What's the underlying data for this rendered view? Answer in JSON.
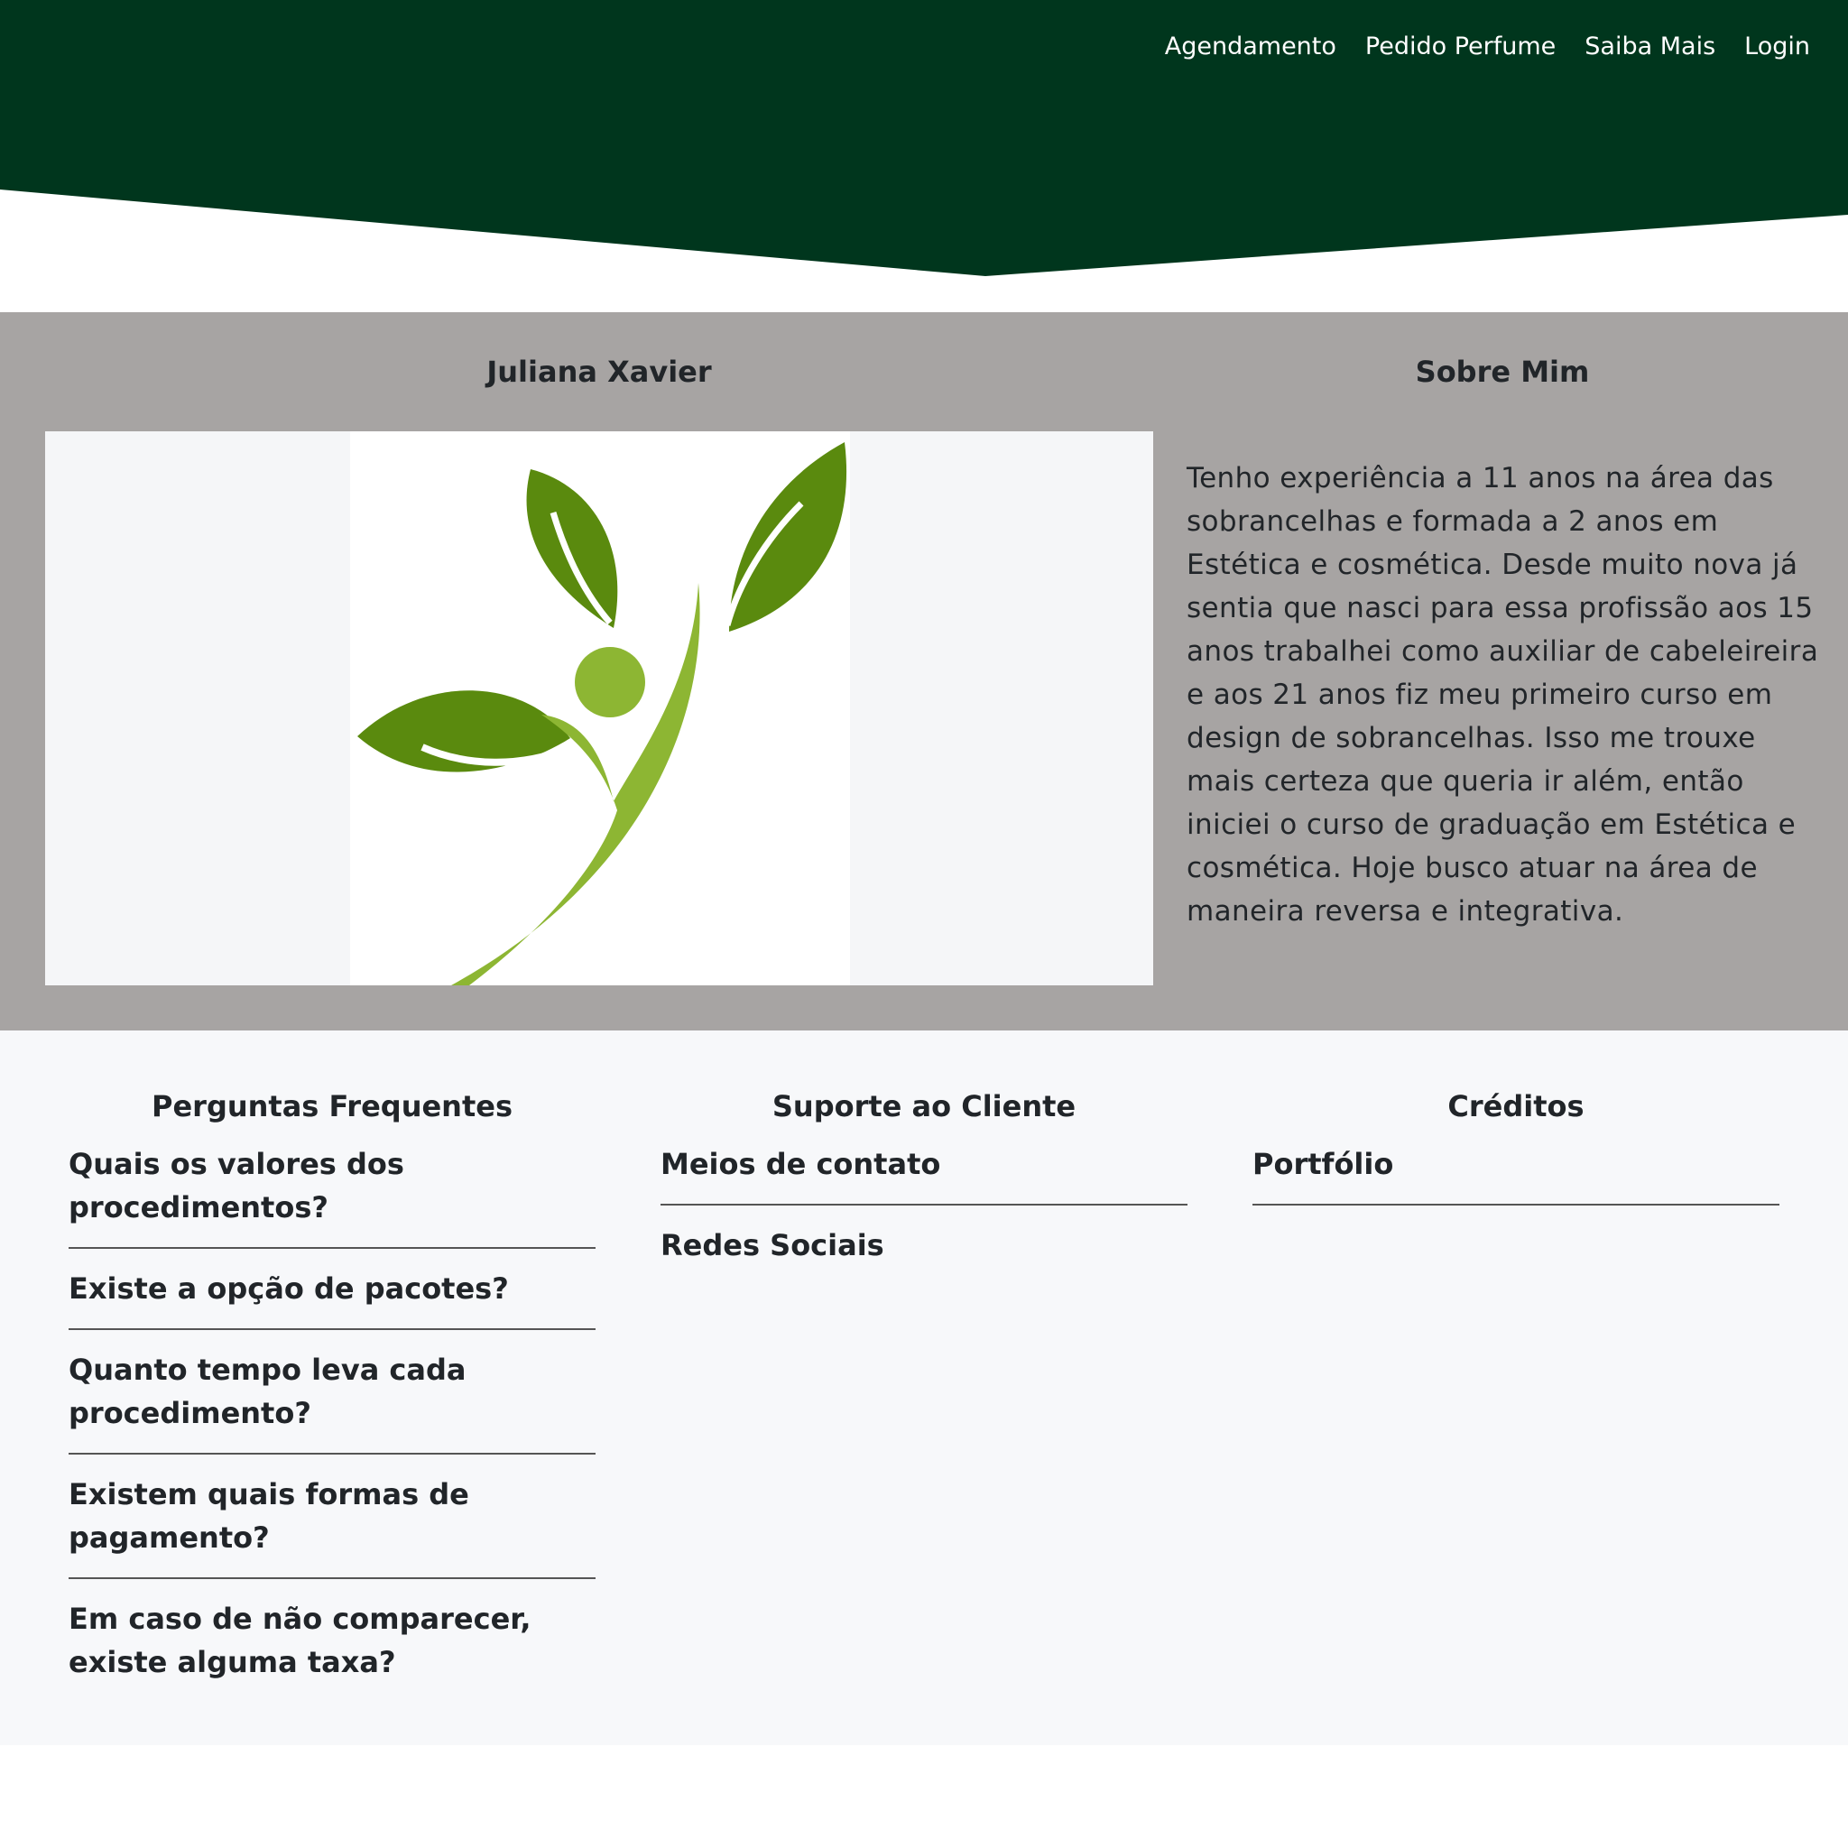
{
  "colors": {
    "header_green": "#00361d",
    "about_bg": "#a7a4a3",
    "footer_bg": "#f7f8fa",
    "leaf_dark": "#5a8a0e",
    "leaf_light": "#8db633"
  },
  "nav": {
    "items": [
      "Agendamento",
      "Pedido Perfume",
      "Saiba Mais",
      "Login"
    ]
  },
  "about": {
    "name": "Juliana Xavier",
    "sobre_title": "Sobre Mim",
    "bio": "Tenho experiência a 11 anos na área das sobrancelhas e formada a 2 anos em Estética e cosmética. Desde muito nova já sentia que nasci para essa profissão aos 15 anos trabalhei como auxiliar de cabeleireira e aos 21 anos fiz meu primeiro curso em design de sobrancelhas. Isso me trouxe mais certeza que queria ir além, então iniciei o curso de graduação em Estética e cosmética. Hoje busco atuar na área de maneira reversa e integrativa."
  },
  "footer": {
    "faq": {
      "title": "Perguntas Frequentes",
      "items": [
        "Quais os valores dos procedimentos?",
        "Existe a opção de pacotes?",
        "Quanto tempo leva cada procedimento?",
        "Existem quais formas de pagamento?",
        "Em caso de não comparecer, existe alguma taxa?"
      ]
    },
    "support": {
      "title": "Suporte ao Cliente",
      "items": [
        "Meios de contato",
        "Redes Sociais"
      ]
    },
    "credits": {
      "title": "Créditos",
      "items": [
        "Portfólio"
      ]
    }
  }
}
